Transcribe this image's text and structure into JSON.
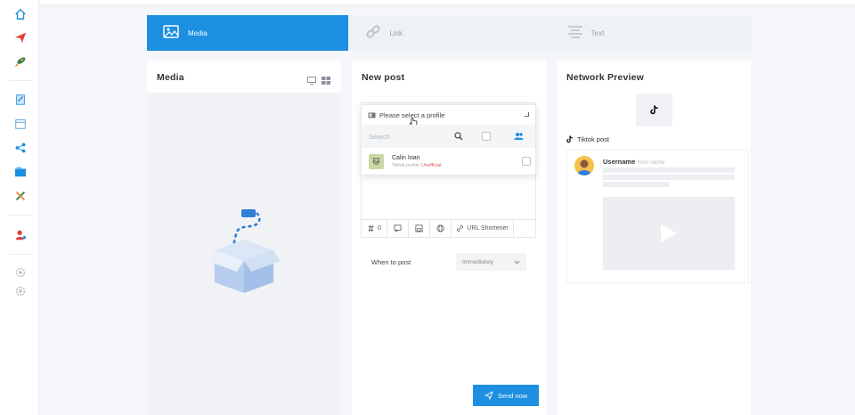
{
  "tabs": [
    {
      "label": "Media",
      "icon": "image-icon",
      "active": true
    },
    {
      "label": "Link",
      "icon": "link-icon",
      "active": false
    },
    {
      "label": "Text",
      "icon": "text-icon",
      "active": false
    }
  ],
  "media_panel": {
    "title": "Media"
  },
  "post_panel": {
    "title": "New post",
    "profile_placeholder": "Please select a profile",
    "search_placeholder": "Search",
    "profile_item": {
      "name": "Calin Ioan",
      "network": "Tiktok profile",
      "badge": "Unofficial"
    },
    "toolbar": {
      "count": "0",
      "url_shortener": "URL Shortener"
    },
    "when_label": "When to post",
    "when_value": "Immediately",
    "send_label": "Send now"
  },
  "preview_panel": {
    "title": "Network Preview",
    "post_type": "Tiktok post",
    "username": "Username",
    "username_hint": "Your name"
  },
  "colors": {
    "accent": "#1c8fe0",
    "danger": "#e05a5a",
    "muted": "#f0f2f5"
  }
}
